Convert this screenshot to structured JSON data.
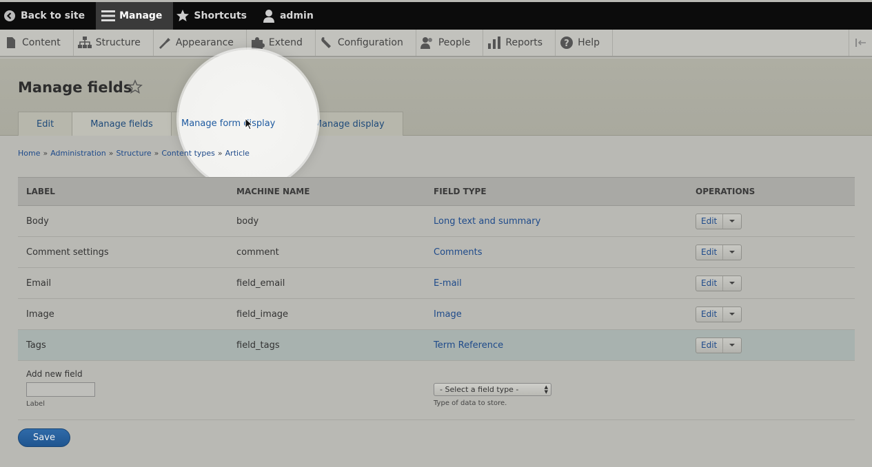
{
  "toolbar": {
    "back": "Back to site",
    "manage": "Manage",
    "shortcuts": "Shortcuts",
    "user": "admin"
  },
  "tray": {
    "items": [
      "Content",
      "Structure",
      "Appearance",
      "Extend",
      "Configuration",
      "People",
      "Reports",
      "Help"
    ]
  },
  "page": {
    "title": "Manage fields"
  },
  "tabs": [
    "Edit",
    "Manage fields",
    "Manage form display",
    "Manage display"
  ],
  "breadcrumb": [
    "Home",
    "Administration",
    "Structure",
    "Content types",
    "Article"
  ],
  "table": {
    "headers": [
      "LABEL",
      "MACHINE NAME",
      "FIELD TYPE",
      "OPERATIONS"
    ],
    "rows": [
      {
        "label": "Body",
        "machine": "body",
        "type": "Long text and summary",
        "op": "Edit"
      },
      {
        "label": "Comment settings",
        "machine": "comment",
        "type": "Comments",
        "op": "Edit"
      },
      {
        "label": "Email",
        "machine": "field_email",
        "type": "E-mail",
        "op": "Edit"
      },
      {
        "label": "Image",
        "machine": "field_image",
        "type": "Image",
        "op": "Edit"
      },
      {
        "label": "Tags",
        "machine": "field_tags",
        "type": "Term Reference",
        "op": "Edit"
      }
    ]
  },
  "add_field": {
    "title": "Add new field",
    "input_label": "Label",
    "select_value": "- Select a field type -",
    "select_help": "Type of data to store."
  },
  "save_label": "Save"
}
